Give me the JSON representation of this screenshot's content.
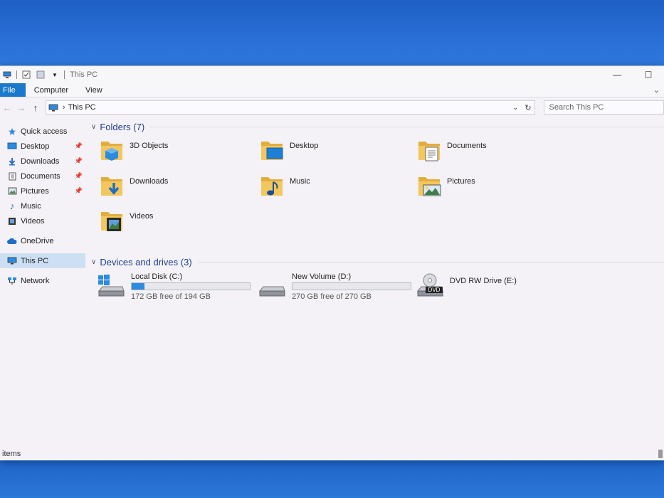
{
  "window": {
    "title": "This PC"
  },
  "ribbon": {
    "tabs": [
      "File",
      "Computer",
      "View"
    ]
  },
  "address": {
    "crumb": "This PC"
  },
  "search": {
    "placeholder": "Search This PC"
  },
  "nav": {
    "quick_access": "Quick access",
    "pinned": [
      {
        "label": "Desktop",
        "icon": "desktop-icon"
      },
      {
        "label": "Downloads",
        "icon": "downloads-icon"
      },
      {
        "label": "Documents",
        "icon": "documents-icon"
      },
      {
        "label": "Pictures",
        "icon": "pictures-icon"
      },
      {
        "label": "Music",
        "icon": "music-icon"
      },
      {
        "label": "Videos",
        "icon": "videos-icon"
      }
    ],
    "onedrive": "OneDrive",
    "thispc": "This PC",
    "network": "Network"
  },
  "folders": {
    "header": "Folders (7)",
    "items": [
      "3D Objects",
      "Desktop",
      "Documents",
      "Downloads",
      "Music",
      "Pictures",
      "Videos"
    ]
  },
  "drives": {
    "header": "Devices and drives (3)",
    "items": [
      {
        "name": "Local Disk (C:)",
        "free": "172 GB free of 194 GB",
        "used_fraction": 0.11
      },
      {
        "name": "New Volume (D:)",
        "free": "270 GB free of 270 GB",
        "used_fraction": 0.0
      },
      {
        "name": "DVD RW Drive (E:)",
        "label_on_icon": "DVD"
      }
    ]
  },
  "status": {
    "text": "items"
  },
  "colors": {
    "accent": "#1979ca",
    "folder": "#e8b64c",
    "selected": "#cde0f3"
  }
}
